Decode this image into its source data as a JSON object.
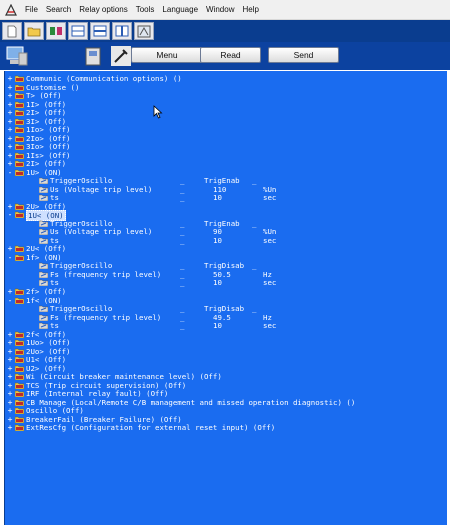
{
  "menu": [
    "File",
    "Search",
    "Relay options",
    "Tools",
    "Language",
    "Window",
    "Help"
  ],
  "toolbar": {
    "menu_label": "Menu",
    "read_label": "Read",
    "send_label": "Send"
  },
  "tree": [
    {
      "exp": "+",
      "text": "Communic (Communication options) ()"
    },
    {
      "exp": "+",
      "text": "Customise ()"
    },
    {
      "exp": "+",
      "text": "T> (Off)"
    },
    {
      "exp": "+",
      "text": "1I> (Off)"
    },
    {
      "exp": "+",
      "text": "2I> (Off)"
    },
    {
      "exp": "+",
      "text": "3I> (Off)"
    },
    {
      "exp": "+",
      "text": "1Io> (Off)"
    },
    {
      "exp": "+",
      "text": "2Io> (Off)"
    },
    {
      "exp": "+",
      "text": "3Io> (Off)"
    },
    {
      "exp": "+",
      "text": "1Is> (Off)"
    },
    {
      "exp": "+",
      "text": "2I> (Off)"
    },
    {
      "exp": "-",
      "text": "1U> (ON)",
      "params": [
        {
          "name": "TriggerOscillo",
          "us": "_",
          "val": "TrigEnab",
          "unit": "_"
        },
        {
          "name": "Us (Voltage trip level)",
          "us": "_",
          "val": "110",
          "unit": "%Un"
        },
        {
          "name": "ts",
          "us": "_",
          "val": "10",
          "unit": "sec"
        }
      ]
    },
    {
      "exp": "+",
      "text": "2U> (Off)"
    },
    {
      "exp": "-",
      "text": "1U< (ON)",
      "selected": true,
      "params": [
        {
          "name": "TriggerOscillo",
          "us": "_",
          "val": "TrigEnab",
          "unit": "_"
        },
        {
          "name": "Us (Voltage trip level)",
          "us": "_",
          "val": "90",
          "unit": "%Un"
        },
        {
          "name": "ts",
          "us": "_",
          "val": "10",
          "unit": "sec"
        }
      ]
    },
    {
      "exp": "+",
      "text": "2U< (Off)"
    },
    {
      "exp": "-",
      "text": "1f> (ON)",
      "params": [
        {
          "name": "TriggerOscillo",
          "us": "_",
          "val": "TrigDisab",
          "unit": "_"
        },
        {
          "name": "Fs (frequency trip level)",
          "us": "_",
          "val": "50.5",
          "unit": "Hz"
        },
        {
          "name": "ts",
          "us": "_",
          "val": "10",
          "unit": "sec"
        }
      ]
    },
    {
      "exp": "+",
      "text": "2f> (Off)"
    },
    {
      "exp": "-",
      "text": "1f< (ON)",
      "params": [
        {
          "name": "TriggerOscillo",
          "us": "_",
          "val": "TrigDisab",
          "unit": "_"
        },
        {
          "name": "Fs (frequency trip level)",
          "us": "_",
          "val": "49.5",
          "unit": "Hz"
        },
        {
          "name": "ts",
          "us": "_",
          "val": "10",
          "unit": "sec"
        }
      ]
    },
    {
      "exp": "+",
      "text": "2f< (Off)"
    },
    {
      "exp": "+",
      "text": "1Uo> (Off)"
    },
    {
      "exp": "+",
      "text": "2Uo> (Off)"
    },
    {
      "exp": "+",
      "text": "U1< (Off)"
    },
    {
      "exp": "+",
      "text": "U2> (Off)"
    },
    {
      "exp": "+",
      "text": "Wi (Circuit breaker maintenance level) (Off)"
    },
    {
      "exp": "+",
      "text": "TCS (Trip circuit supervision) (Off)"
    },
    {
      "exp": "+",
      "text": "IRF (Internal relay fault) (Off)"
    },
    {
      "exp": "+",
      "text": "CB Manage (Local/Remote C/B management and missed operation diagnostic) ()"
    },
    {
      "exp": "+",
      "text": "Oscillo (Off)"
    },
    {
      "exp": "+",
      "text": "BreakerFail (Breaker Failure) (Off)"
    },
    {
      "exp": "+",
      "text": "ExtResCfg (Configuration for external reset input) (Off)"
    }
  ]
}
